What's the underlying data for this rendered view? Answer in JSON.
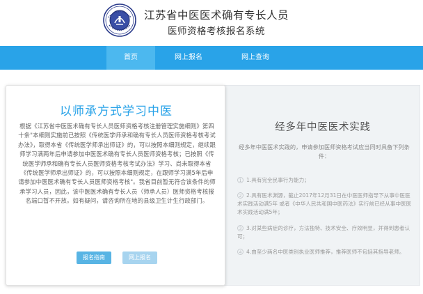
{
  "header": {
    "title_line1": "江苏省中医医术确有专长人员",
    "title_line2": "医师资格考核报名系统",
    "logo_icon": "provincial-seal-icon"
  },
  "nav": {
    "home": "首页",
    "apply": "网上报名",
    "query": "网上查询"
  },
  "left_card": {
    "title": "以师承方式学习中医",
    "body": "根据《江苏省中医医术确有专长人员医师资格考核注册管理实施细则》第四十条\"本细则实施前已按照《传统医学师承和确有专长人员医师资格考核考试办法》，取得本省《传统医学师承出师证》的，可以按照本细则规定，继续跟师学习满两年后申请参加中医医术确有专长人员医师资格考核；已按照《传统医学师承和确有专长人员医师资格考核考试办法》学习、尚未取得本省《传统医学师承出师证》的，可以按照本细则规定，在跟师学习满5年后申请参加中医医术确有专长人员医师资格考核\"。我省目前暂无符合该条件的师承学习人员，因此，该中医医术确有专长人员（师承人员）医师资格考核报名端口暂不开放。如有疑问，请咨询所在地的县级卫生计生行政部门。",
    "btn_guide": "报名指南",
    "btn_apply": "网上报名"
  },
  "right_card": {
    "title": "经多年中医医术实践",
    "intro": "经多年中医医术实践的，申请参加医师资格考试应当同时具备下列条件：",
    "conditions": [
      {
        "num": "1",
        "text": "1.具有完全民事行为能力；"
      },
      {
        "num": "2",
        "text": "2.具有医术渊源，截止2017年12月31日在中医医师指导下从事中医医术实践活动满5年 或者《中华人民共和国中医药法》实行前已经从事中医医术实践活动满5年；"
      },
      {
        "num": "3",
        "text": "3.对某些病症的诊疗，方法独特、技术安全、疗效明显，并得到患者认可；"
      },
      {
        "num": "4",
        "text": "4.由至少两名中医类别执业医师推荐，推荐医师不包括其指导老师。"
      }
    ]
  },
  "colors": {
    "nav_bg": "#29a3e8",
    "accent": "#29a3e8",
    "button": "#58b4e4"
  }
}
